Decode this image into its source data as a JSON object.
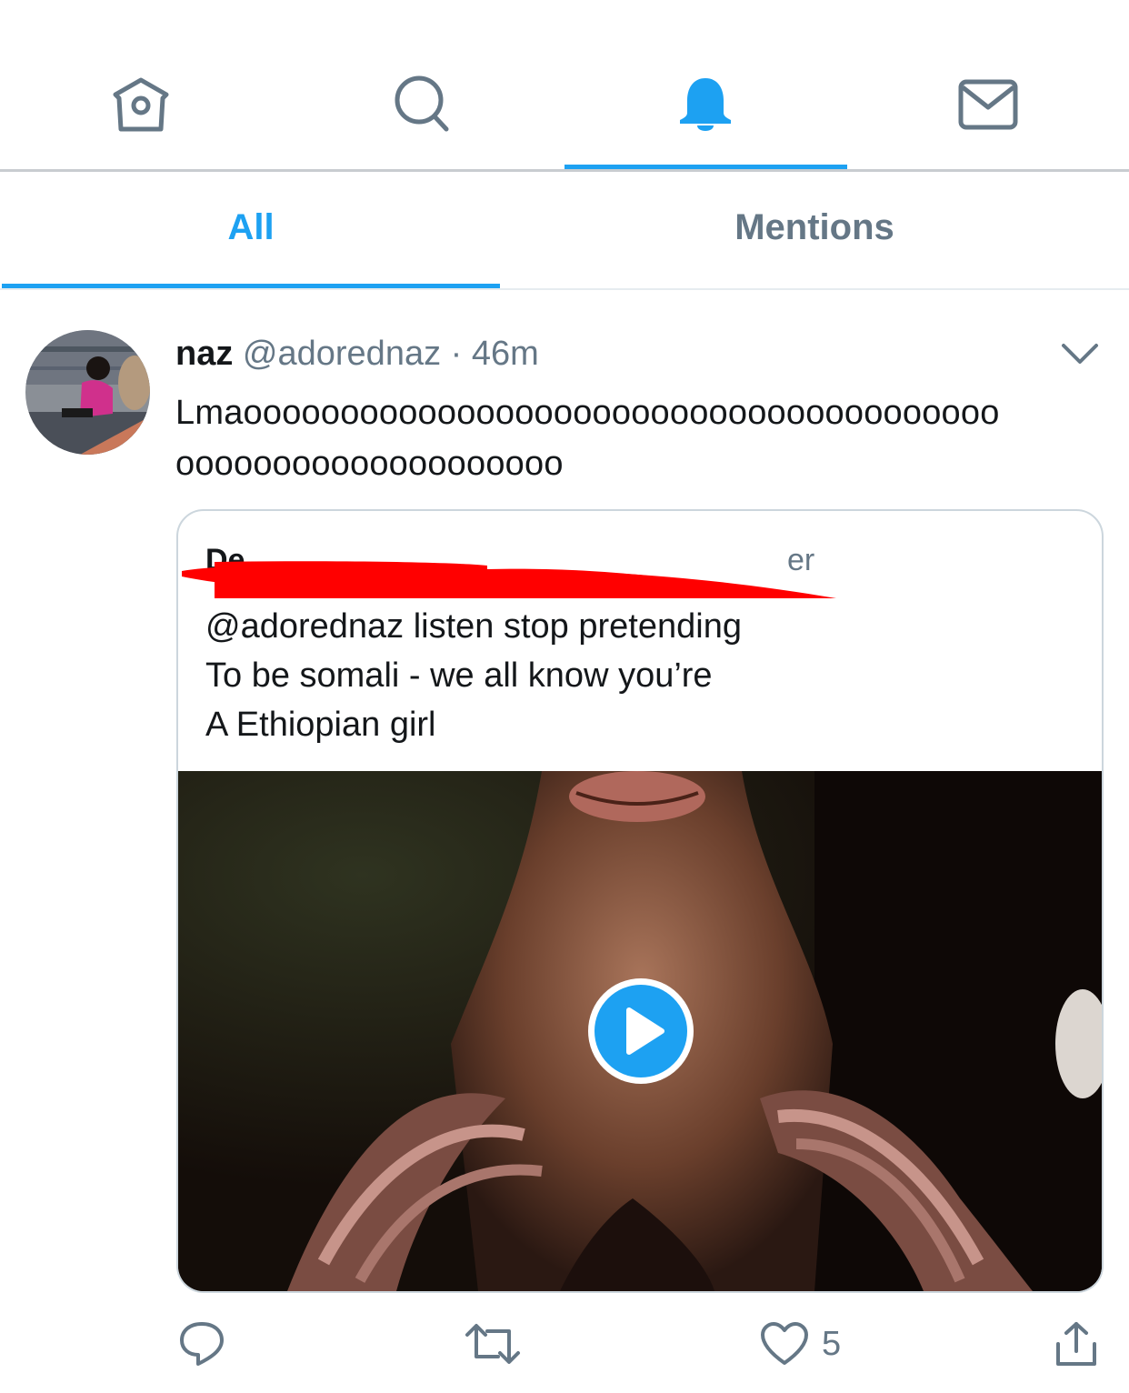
{
  "nav": {
    "items": [
      {
        "id": "home",
        "icon": "home-icon"
      },
      {
        "id": "search",
        "icon": "search-icon"
      },
      {
        "id": "notifications",
        "icon": "bell-icon",
        "active": true
      },
      {
        "id": "messages",
        "icon": "envelope-icon"
      }
    ],
    "accent_color": "#1da1f2",
    "inactive_color": "#657786"
  },
  "tabs": {
    "all": "All",
    "mentions": "Mentions",
    "active": "all"
  },
  "tweet": {
    "name": "naz",
    "handle": "@adorednaz",
    "separator": "·",
    "time": "46m",
    "text_line1": "Lmaooooooooooooooooooooooooooooooooooooooo",
    "text_line2": "oooooooooooooooooooo",
    "quote": {
      "author_visible": "De",
      "author_visible_tail": "er",
      "author_redacted": true,
      "redaction_color": "#ff0000",
      "line1": "@adorednaz listen stop pretending",
      "line2": "To be somali - we all know you’re",
      "line3": "A Ethiopian girl",
      "media": "video",
      "play_icon": "play-icon"
    },
    "actions": {
      "reply_icon": "reply-icon",
      "retweet_icon": "retweet-icon",
      "like_icon": "heart-icon",
      "like_count": "5",
      "share_icon": "share-icon"
    }
  }
}
